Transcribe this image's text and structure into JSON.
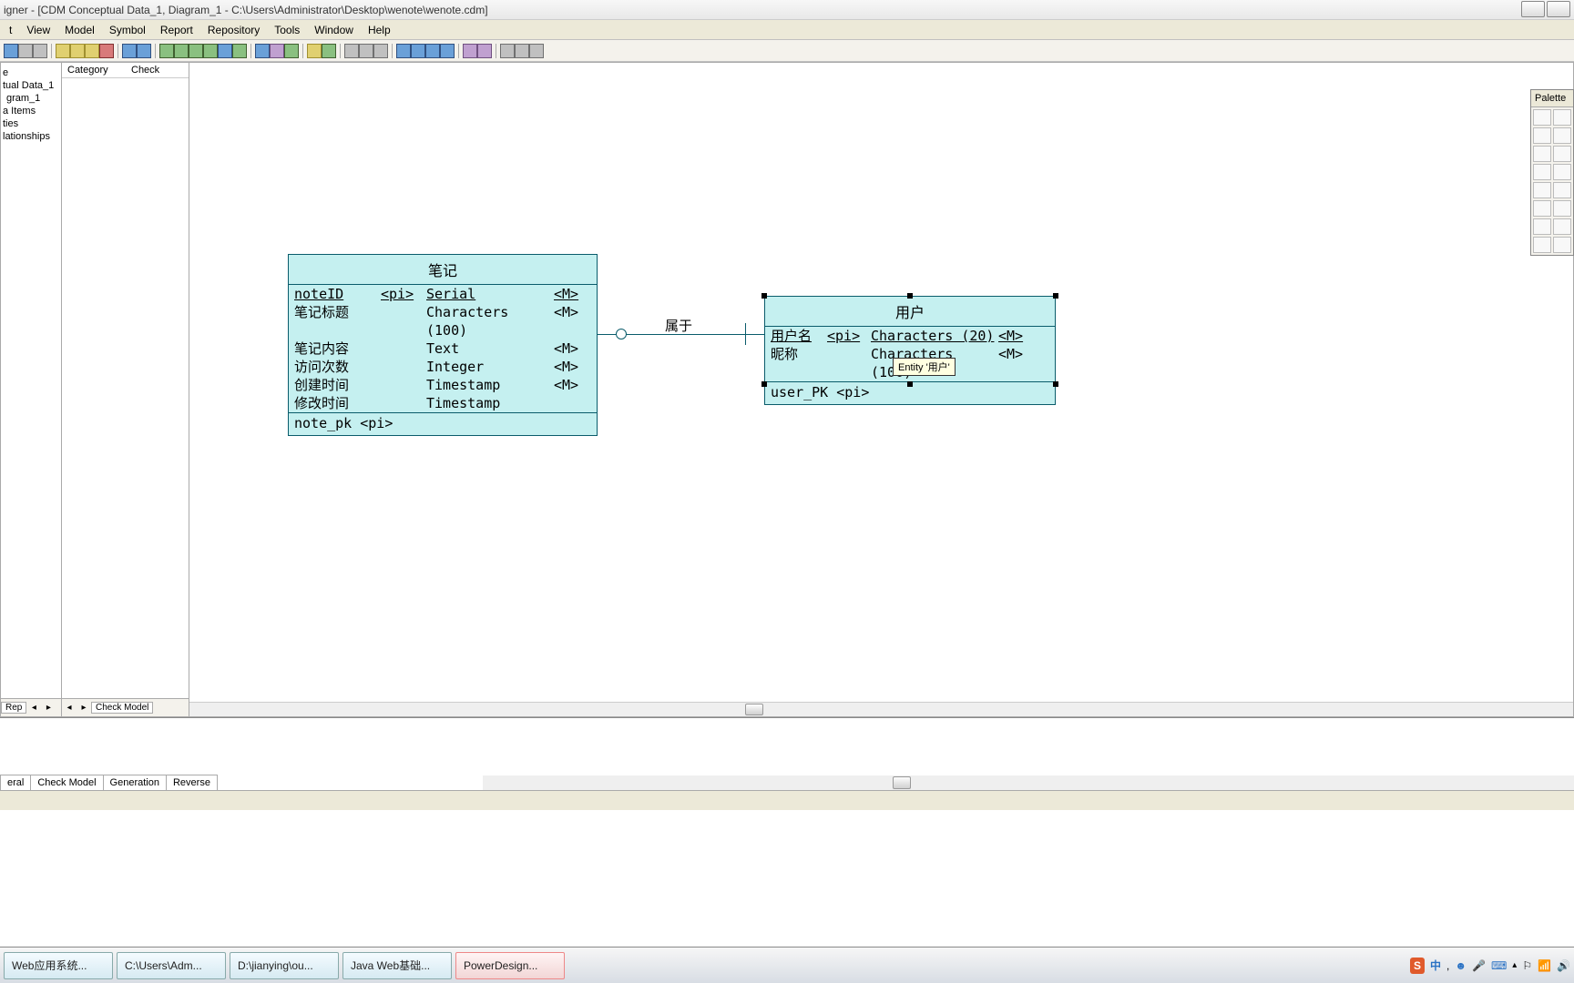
{
  "window": {
    "title": "igner - [CDM Conceptual Data_1, Diagram_1 - C:\\Users\\Administrator\\Desktop\\wenote\\wenote.cdm]"
  },
  "menu": {
    "items": [
      "t",
      "View",
      "Model",
      "Symbol",
      "Report",
      "Repository",
      "Tools",
      "Window",
      "Help"
    ]
  },
  "left_tree": {
    "items": [
      "e",
      "tual Data_1",
      "gram_1",
      "a Items",
      "ties",
      "lationships"
    ]
  },
  "check_panel": {
    "col_category": "Category",
    "col_check": "Check",
    "tab_label": "Check Model"
  },
  "left_bottom_tab": "Rep",
  "canvas": {
    "entity_note": {
      "title": "笔记",
      "rows": [
        {
          "name": "noteID",
          "pi": "<pi>",
          "type": "Serial",
          "m": "<M>",
          "u": true
        },
        {
          "name": "笔记标题",
          "pi": "",
          "type": "Characters (100)",
          "m": "<M>"
        },
        {
          "name": "笔记内容",
          "pi": "",
          "type": "Text",
          "m": "<M>"
        },
        {
          "name": "访问次数",
          "pi": "",
          "type": "Integer",
          "m": "<M>"
        },
        {
          "name": "创建时间",
          "pi": "",
          "type": "Timestamp",
          "m": "<M>"
        },
        {
          "name": "修改时间",
          "pi": "",
          "type": "Timestamp",
          "m": ""
        }
      ],
      "pk": "note_pk  <pi>"
    },
    "entity_user": {
      "title": "用户",
      "rows": [
        {
          "name": "用户名",
          "pi": "<pi>",
          "type": "Characters (20)",
          "m": "<M>",
          "u": true
        },
        {
          "name": "昵称",
          "pi": "",
          "type": "Characters (100)",
          "m": "<M>"
        }
      ],
      "pk": "user_PK  <pi>"
    },
    "relation_label": "属于",
    "tooltip": "Entity '用户'"
  },
  "palette": {
    "title": "Palette"
  },
  "output_tabs": [
    "eral",
    "Check Model",
    "Generation",
    "Reverse"
  ],
  "taskbar": {
    "items": [
      "Web应用系统...",
      "C:\\Users\\Adm...",
      "D:\\jianying\\ou...",
      "Java Web基础...",
      "PowerDesign..."
    ],
    "ime": "中"
  }
}
